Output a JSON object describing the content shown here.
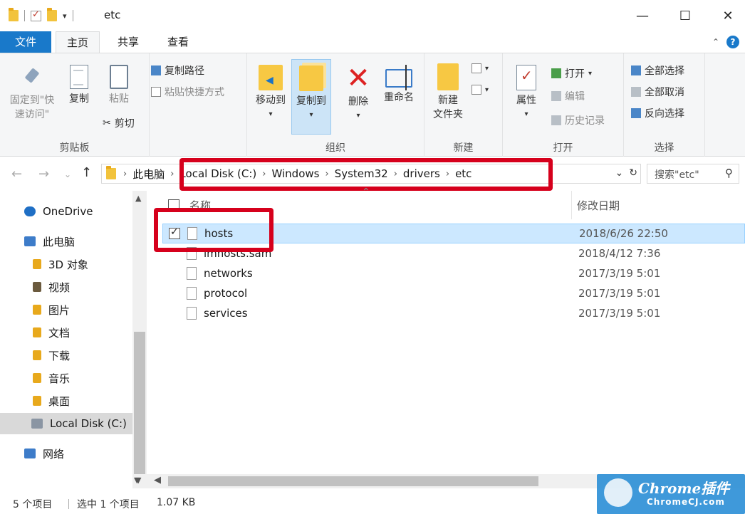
{
  "window": {
    "title": "etc",
    "minimize": "—",
    "maximize": "☐",
    "close": "✕"
  },
  "tabs": {
    "file": "文件",
    "home": "主页",
    "share": "共享",
    "view": "查看"
  },
  "ribbon": {
    "clipboard": {
      "label": "剪贴板",
      "pin": "固定到\"快速访问\"",
      "pin_line1": "固定到\"快",
      "pin_line2": "速访问\"",
      "copy": "复制",
      "paste": "粘贴",
      "copy_path": "复制路径",
      "paste_shortcut": "粘贴快捷方式",
      "cut": "剪切"
    },
    "organize": {
      "label": "组织",
      "move_to": "移动到",
      "copy_to": "复制到",
      "delete": "删除",
      "rename": "重命名"
    },
    "new": {
      "label": "新建",
      "new_folder_line1": "新建",
      "new_folder_line2": "文件夹"
    },
    "open": {
      "label": "打开",
      "properties": "属性",
      "open": "打开",
      "edit": "编辑",
      "history": "历史记录"
    },
    "select": {
      "label": "选择",
      "select_all": "全部选择",
      "select_none": "全部取消",
      "invert": "反向选择"
    }
  },
  "address": {
    "crumbs": [
      "此电脑",
      "Local Disk (C:)",
      "Windows",
      "System32",
      "drivers",
      "etc"
    ],
    "search_placeholder": "搜索\"etc\""
  },
  "nav": {
    "items": [
      {
        "label": "OneDrive",
        "icon": "cloud-icon",
        "color": "#1f6fc5"
      },
      {
        "label": "此电脑",
        "icon": "computer-icon",
        "color": "#3d7cc9"
      },
      {
        "label": "3D 对象",
        "icon": "3d-objects-icon",
        "color": "#e8a91c"
      },
      {
        "label": "视频",
        "icon": "video-icon",
        "color": "#6b5a3e"
      },
      {
        "label": "图片",
        "icon": "pictures-icon",
        "color": "#e8a91c"
      },
      {
        "label": "文档",
        "icon": "documents-icon",
        "color": "#e8a91c"
      },
      {
        "label": "下载",
        "icon": "downloads-icon",
        "color": "#e8a91c"
      },
      {
        "label": "音乐",
        "icon": "music-icon",
        "color": "#e8a91c"
      },
      {
        "label": "桌面",
        "icon": "desktop-icon",
        "color": "#e8a91c"
      },
      {
        "label": "Local Disk (C:)",
        "icon": "drive-icon",
        "color": "#8a95a3"
      },
      {
        "label": "网络",
        "icon": "network-icon",
        "color": "#3d7cc9"
      }
    ]
  },
  "filelist": {
    "col_name": "名称",
    "col_date": "修改日期",
    "rows": [
      {
        "name": "hosts",
        "date": "2018/6/26 22:50"
      },
      {
        "name": "lmhosts.sam",
        "date": "2018/4/12 7:36"
      },
      {
        "name": "networks",
        "date": "2017/3/19 5:01"
      },
      {
        "name": "protocol",
        "date": "2017/3/19 5:01"
      },
      {
        "name": "services",
        "date": "2017/3/19 5:01"
      }
    ]
  },
  "status": {
    "count": "5 个项目",
    "selected": "选中 1 个项目",
    "size": "1.07 KB"
  },
  "watermark": {
    "title": "Chrome插件",
    "sub": "ChromeCJ.com"
  },
  "colors": {
    "accent": "#1979ca",
    "highlight_box": "#d6001c",
    "selection": "#cce8ff"
  }
}
